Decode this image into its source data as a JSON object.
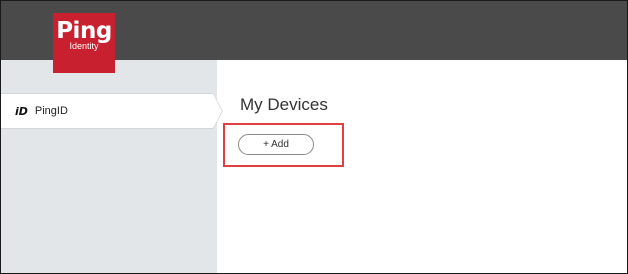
{
  "header": {
    "logo_text": "Ping",
    "logo_subtext": "Identity",
    "logo_color": "#c8202f",
    "bar_color": "#4a4a4a"
  },
  "sidebar": {
    "items": [
      {
        "icon": "id-icon",
        "icon_text": "iD",
        "label": "PingID"
      }
    ]
  },
  "main": {
    "title": "My Devices",
    "add_button_label": "+ Add",
    "highlight_color": "#e24040"
  }
}
